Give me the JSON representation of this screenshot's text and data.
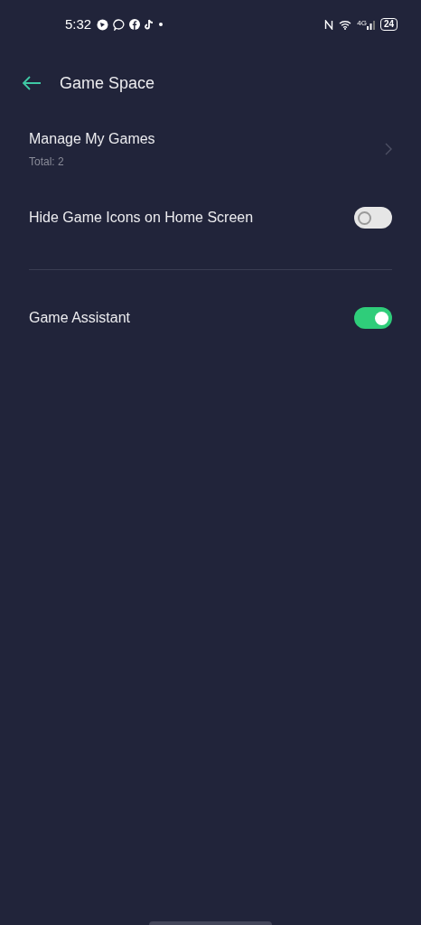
{
  "status_bar": {
    "time": "5:32",
    "network": "4G",
    "battery": "24"
  },
  "header": {
    "title": "Game Space"
  },
  "sections": [
    {
      "items": [
        {
          "kind": "nav",
          "label": "Manage My Games",
          "subtitle": "Total: 2"
        },
        {
          "kind": "switch",
          "label": "Hide Game Icons on Home Screen",
          "on": false
        }
      ]
    },
    {
      "items": [
        {
          "kind": "switch",
          "label": "Game Assistant",
          "on": true
        }
      ]
    }
  ]
}
